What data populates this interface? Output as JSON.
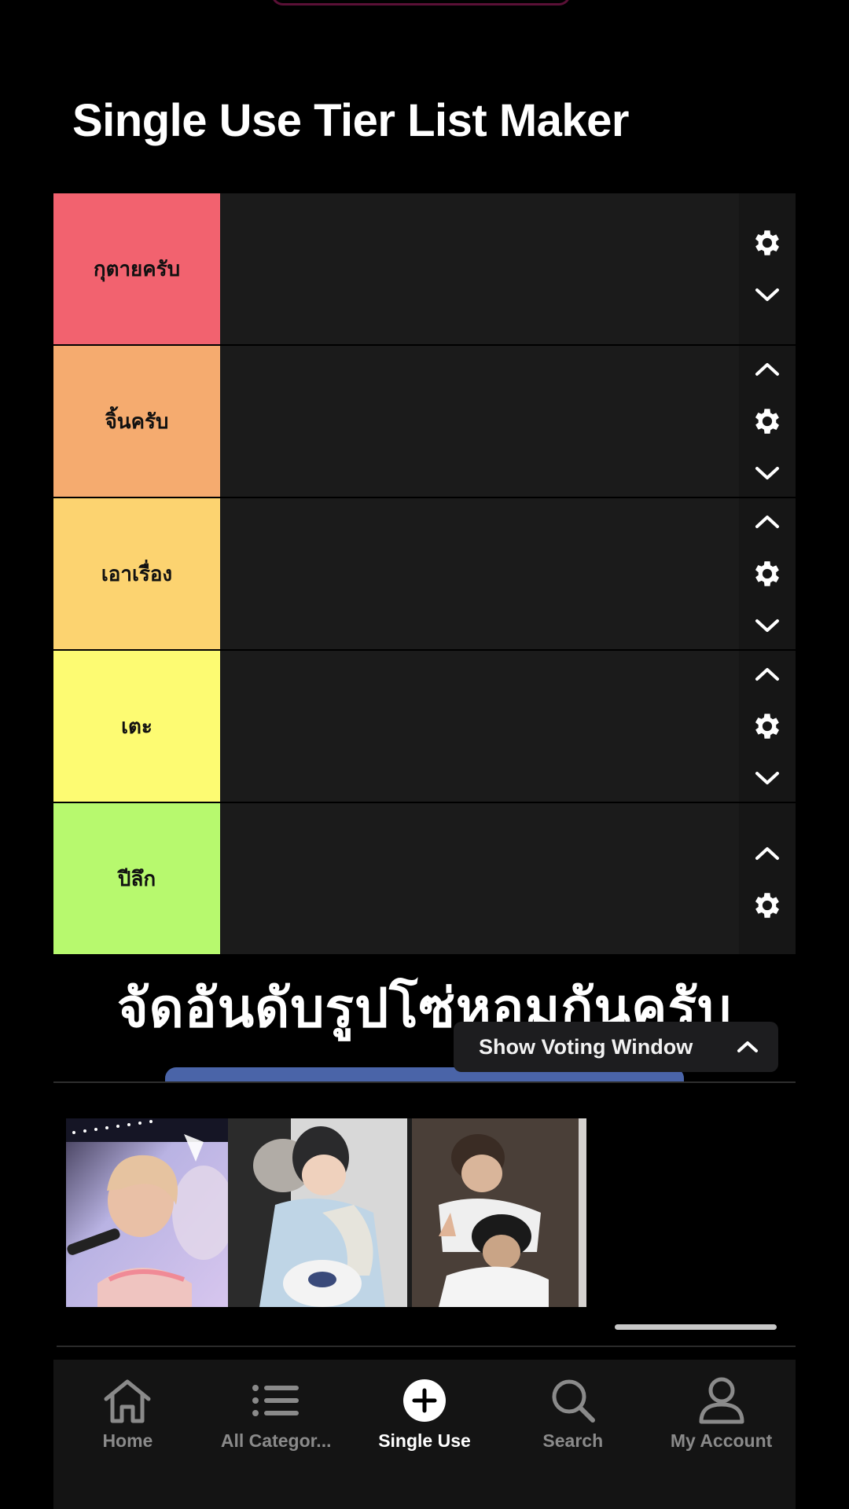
{
  "title": "Single Use Tier List Maker",
  "tiers": [
    {
      "label": "กุตายครับ",
      "color": "#f2626f",
      "show_up": false,
      "show_down": true
    },
    {
      "label": "จิ้นครับ",
      "color": "#f5ab6f",
      "show_up": true,
      "show_down": true
    },
    {
      "label": "เอาเรื่อง",
      "color": "#fcd370",
      "show_up": true,
      "show_down": true
    },
    {
      "label": "เตะ",
      "color": "#fdfb72",
      "show_up": true,
      "show_down": true
    },
    {
      "label": "ปีลึก",
      "color": "#b7f96e",
      "show_up": true,
      "show_down": false
    }
  ],
  "overlay_caption": "จัดอันดับรูปโซ่หอมกันครับ",
  "voting": {
    "label": "Show Voting Window",
    "icon": "chevron-up-icon"
  },
  "images": [
    {
      "name": "photo-concert-singer"
    },
    {
      "name": "photo-two-friends-sitting"
    },
    {
      "name": "photo-hug-polaroid"
    }
  ],
  "nav": [
    {
      "label": "Home",
      "icon": "home-icon",
      "active": false
    },
    {
      "label": "All Categor...",
      "icon": "list-icon",
      "active": false
    },
    {
      "label": "Single Use",
      "icon": "plus-circle-icon",
      "active": true
    },
    {
      "label": "Search",
      "icon": "search-icon",
      "active": false
    },
    {
      "label": "My Account",
      "icon": "account-icon",
      "active": false
    }
  ],
  "colors": {
    "background": "#000000",
    "row_bg": "#1b1b1b",
    "accent_bar": "#4a64a8"
  }
}
